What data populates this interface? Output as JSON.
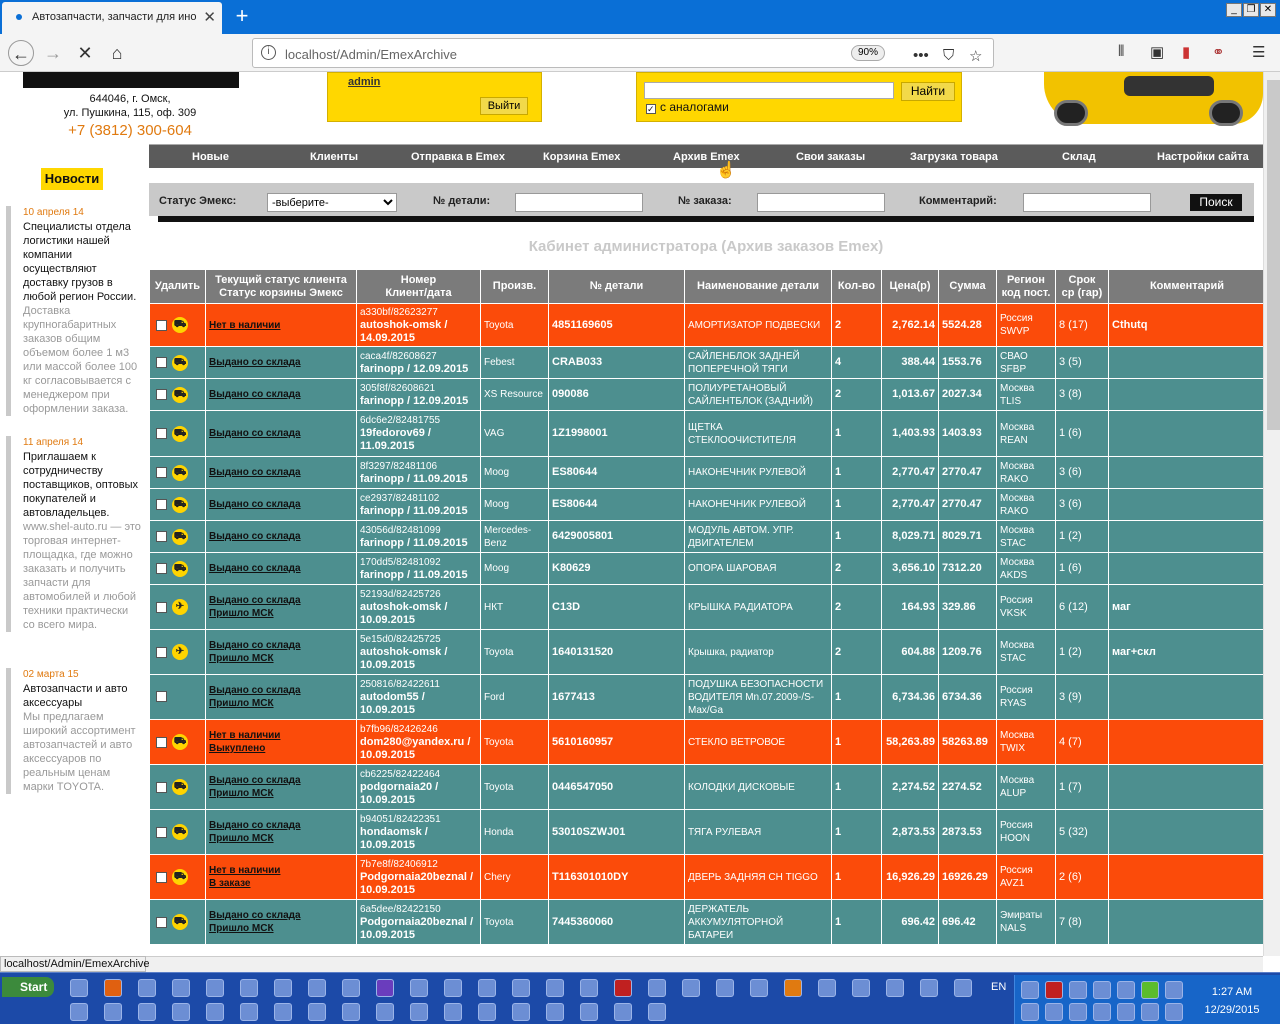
{
  "browser": {
    "tab_title": "Автозапчасти, запчасти для ино",
    "url_base": "localhost",
    "url_path": "/Admin/EmexArchive",
    "zoom": "90%",
    "status_url": "localhost/Admin/EmexArchive"
  },
  "header": {
    "address_line1": "644046, г. Омск,",
    "address_line2": "ул. Пушкина, 115, оф. 309",
    "phone": "+7 (3812) 300-604",
    "admin_link": "admin",
    "logout_button": "Выйти",
    "find_button": "Найти",
    "analog_label": "с аналогами"
  },
  "menu": [
    "Новые",
    "Клиенты",
    "Отправка в Emex",
    "Корзина Emex",
    "Архив Emex",
    "Свои заказы",
    "Загрузка товара",
    "Склад",
    "Настройки сайта"
  ],
  "filters": {
    "status_label": "Статус Эмекс:",
    "status_value": "-выберите-",
    "detail_label": "№ детали:",
    "order_label": "№ заказа:",
    "comment_label": "Комментарий:",
    "search_button": "Поиск"
  },
  "cabinet_title": "Кабинет администратора (Архив заказов Emex)",
  "news": {
    "header": "Новости",
    "items": [
      {
        "date": "10 апреля 14",
        "title": "Специалисты отдела логистики нашей компании осуществляют доставку грузов в любой регион России.",
        "body": "Доставка крупногабаритных заказов общим объемом более 1 м3 или массой более 100 кг согласовывается с менеджером при оформлении заказа."
      },
      {
        "date": "11 апреля 14",
        "title": "Приглашаем к сотрудничеству поставщиков, оптовых покупателей и автовладельцев.",
        "body": "www.shel-auto.ru — это торговая интернет-площадка, где можно заказать и получить запчасти для автомобилей и любой техники практически со всего мира."
      },
      {
        "date": "02 марта 15",
        "title": "Автозапчасти и авто аксессуары",
        "body": "Мы предлагаем широкий ассортимент автозапчастей и авто аксессуаров по реальным ценам марки TOYOTA."
      }
    ]
  },
  "table": {
    "headers": {
      "delete": "Удалить",
      "status1": "Текущий статус клиента",
      "status2": "Статус корзины Эмекс",
      "num1": "Номер",
      "num2": "Клиент/дата",
      "maker": "Произв.",
      "part": "№ детали",
      "name": "Наименование детали",
      "qty": "Кол-во",
      "price": "Цена(р)",
      "sum": "Сумма",
      "region1": "Регион",
      "region2": "код пост.",
      "term1": "Срок",
      "term2": "ср (гар)",
      "comment": "Комментарий"
    },
    "rows": [
      {
        "color": "o",
        "icon": "truck",
        "status1": "Нет в наличии",
        "status2": "",
        "num": "a330bf/82623277",
        "client": "autoshok-omsk / 14.09.2015",
        "maker": "Toyota",
        "part": "4851169605",
        "name": "АМОРТИЗАТОР ПОДВЕСКИ",
        "qty": "2",
        "price": "2,762.14",
        "sum": "5524.28",
        "region": "Россия",
        "code": "SWVP",
        "term": "8 (17)",
        "comment": "Cthutq"
      },
      {
        "color": "g",
        "icon": "truck",
        "status1": "Выдано со склада",
        "status2": "",
        "num": "caca4f/82608627",
        "client": "farinopp / 12.09.2015",
        "maker": "Febest",
        "part": "CRAB033",
        "name": "САЙЛЕНБЛОК ЗАДНЕЙ ПОПЕРЕЧНОЙ ТЯГИ",
        "qty": "4",
        "price": "388.44",
        "sum": "1553.76",
        "region": "СВАО",
        "code": "SFBP",
        "term": "3 (5)",
        "comment": ""
      },
      {
        "color": "g",
        "icon": "truck",
        "status1": "Выдано со склада",
        "status2": "",
        "num": "305f8f/82608621",
        "client": "farinopp / 12.09.2015",
        "maker": "XS Resource",
        "part": "090086",
        "name": "ПОЛИУРЕТАНОВЫЙ САЙЛЕНТБЛОК (ЗАДНИЙ)",
        "qty": "2",
        "price": "1,013.67",
        "sum": "2027.34",
        "region": "Москва",
        "code": "TLIS",
        "term": "3 (8)",
        "comment": ""
      },
      {
        "color": "g",
        "icon": "truck",
        "status1": "Выдано со склада",
        "status2": "",
        "num": "6dc6e2/82481755",
        "client": "19fedorov69 / 11.09.2015",
        "maker": "VAG",
        "part": "1Z1998001",
        "name": "ЩЕТКА СТЕКЛООЧИСТИТЕЛЯ",
        "qty": "1",
        "price": "1,403.93",
        "sum": "1403.93",
        "region": "Москва",
        "code": "REAN",
        "term": "1 (6)",
        "comment": ""
      },
      {
        "color": "g",
        "icon": "truck",
        "status1": "Выдано со склада",
        "status2": "",
        "num": "8f3297/82481106",
        "client": "farinopp / 11.09.2015",
        "maker": "Moog",
        "part": "ES80644",
        "name": "НАКОНЕЧНИК РУЛЕВОЙ",
        "qty": "1",
        "price": "2,770.47",
        "sum": "2770.47",
        "region": "Москва",
        "code": "RAKO",
        "term": "3 (6)",
        "comment": ""
      },
      {
        "color": "g",
        "icon": "truck",
        "status1": "Выдано со склада",
        "status2": "",
        "num": "ce2937/82481102",
        "client": "farinopp / 11.09.2015",
        "maker": "Moog",
        "part": "ES80644",
        "name": "НАКОНЕЧНИК РУЛЕВОЙ",
        "qty": "1",
        "price": "2,770.47",
        "sum": "2770.47",
        "region": "Москва",
        "code": "RAKO",
        "term": "3 (6)",
        "comment": ""
      },
      {
        "color": "g",
        "icon": "truck",
        "status1": "Выдано со склада",
        "status2": "",
        "num": "43056d/82481099",
        "client": "farinopp / 11.09.2015",
        "maker": "Mercedes-Benz",
        "part": "6429005801",
        "name": "МОДУЛЬ АВТОМ. УПР. ДВИГАТЕЛЕМ",
        "qty": "1",
        "price": "8,029.71",
        "sum": "8029.71",
        "region": "Москва",
        "code": "STAC",
        "term": "1 (2)",
        "comment": ""
      },
      {
        "color": "g",
        "icon": "truck",
        "status1": "Выдано со склада",
        "status2": "",
        "num": "170dd5/82481092",
        "client": "farinopp / 11.09.2015",
        "maker": "Moog",
        "part": "K80629",
        "name": "ОПОРА ШАРОВАЯ",
        "qty": "2",
        "price": "3,656.10",
        "sum": "7312.20",
        "region": "Москва",
        "code": "AKDS",
        "term": "1 (6)",
        "comment": ""
      },
      {
        "color": "g",
        "icon": "plane",
        "status1": "Выдано со склада",
        "status2": "Пришло МСК",
        "num": "52193d/82425726",
        "client": "autoshok-omsk / 10.09.2015",
        "maker": "НКТ",
        "part": "C13D",
        "name": "КРЫШКА РАДИАТОРА",
        "qty": "2",
        "price": "164.93",
        "sum": "329.86",
        "region": "Россия",
        "code": "VKSK",
        "term": "6 (12)",
        "comment": "маг"
      },
      {
        "color": "g",
        "icon": "plane",
        "status1": "Выдано со склада",
        "status2": "Пришло МСК",
        "num": "5e15d0/82425725",
        "client": "autoshok-omsk / 10.09.2015",
        "maker": "Toyota",
        "part": "1640131520",
        "name": "Крышка, радиатор",
        "qty": "2",
        "price": "604.88",
        "sum": "1209.76",
        "region": "Москва",
        "code": "STAC",
        "term": "1 (2)",
        "comment": "маг+скл"
      },
      {
        "color": "g",
        "icon": "",
        "status1": "Выдано со склада",
        "status2": "Пришло МСК",
        "num": "250816/82422611",
        "client": "autodom55 / 10.09.2015",
        "maker": "Ford",
        "part": "1677413",
        "name": "ПОДУШКА БЕЗОПАСНОСТИ ВОДИТЕЛЯ Mn.07.2009-/S-Max/Ga",
        "qty": "1",
        "price": "6,734.36",
        "sum": "6734.36",
        "region": "Россия",
        "code": "RYAS",
        "term": "3 (9)",
        "comment": ""
      },
      {
        "color": "o",
        "icon": "truck",
        "status1": "Нет в наличии",
        "status2": "Выкуплено",
        "num": "b7fb96/82426246",
        "client": "dom280@yandex.ru / 10.09.2015",
        "maker": "Toyota",
        "part": "5610160957",
        "name": "СТЕКЛО ВЕТРОВОЕ",
        "qty": "1",
        "price": "58,263.89",
        "sum": "58263.89",
        "region": "Москва",
        "code": "TWIX",
        "term": "4 (7)",
        "comment": ""
      },
      {
        "color": "g",
        "icon": "truck",
        "status1": "Выдано со склада",
        "status2": "Пришло МСК",
        "num": "cb6225/82422464",
        "client": "podgornaia20 / 10.09.2015",
        "maker": "Toyota",
        "part": "0446547050",
        "name": "КОЛОДКИ ДИСКОВЫЕ",
        "qty": "1",
        "price": "2,274.52",
        "sum": "2274.52",
        "region": "Москва",
        "code": "ALUP",
        "term": "1 (7)",
        "comment": ""
      },
      {
        "color": "g",
        "icon": "truck",
        "status1": "Выдано со склада",
        "status2": "Пришло МСК",
        "num": "b94051/82422351",
        "client": "hondaomsk / 10.09.2015",
        "maker": "Honda",
        "part": "53010SZWJ01",
        "name": "ТЯГА РУЛЕВАЯ",
        "qty": "1",
        "price": "2,873.53",
        "sum": "2873.53",
        "region": "Россия",
        "code": "HOON",
        "term": "5 (32)",
        "comment": ""
      },
      {
        "color": "o",
        "icon": "truck",
        "status1": "Нет в наличии",
        "status2": "В заказе",
        "num": "7b7e8f/82406912",
        "client": "Podgornaia20beznal / 10.09.2015",
        "maker": "Chery",
        "part": "T116301010DY",
        "name": "ДВЕРЬ ЗАДНЯЯ СН TIGGO",
        "qty": "1",
        "price": "16,926.29",
        "sum": "16926.29",
        "region": "Россия",
        "code": "AVZ1",
        "term": "2 (6)",
        "comment": ""
      },
      {
        "color": "g",
        "icon": "truck",
        "status1": "Выдано со склада",
        "status2": "Пришло МСК",
        "num": "6a5dee/82422150",
        "client": "Podgornaia20beznal / 10.09.2015",
        "maker": "Toyota",
        "part": "7445360060",
        "name": "ДЕРЖАТЕЛЬ АККУМУЛЯТОРНОЙ БАТАРЕИ",
        "qty": "1",
        "price": "696.42",
        "sum": "696.42",
        "region": "Эмираты",
        "code": "NALS",
        "term": "7 (8)",
        "comment": ""
      }
    ]
  },
  "taskbar": {
    "start": "Start",
    "lang": "EN",
    "time": "1:27 AM",
    "date": "12/29/2015"
  }
}
